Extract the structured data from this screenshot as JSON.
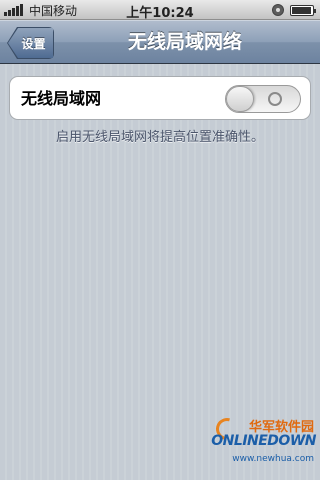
{
  "status_bar": {
    "carrier": "中国移动",
    "time": "上午10:24",
    "signal_bars": 5
  },
  "nav": {
    "back_label": "设置",
    "title": "无线局域网络"
  },
  "settings": {
    "wifi_label": "无线局域网",
    "wifi_enabled": false
  },
  "footnote": "启用无线局域网将提高位置准确性。",
  "watermark": {
    "chinese": "华军软件园",
    "logo": "ONLINEDOWN",
    "url": "www.newhua.com"
  },
  "colors": {
    "nav_bar": "#7d91aa",
    "background": "#c5ccd4",
    "footnote_text": "#4c566c"
  }
}
